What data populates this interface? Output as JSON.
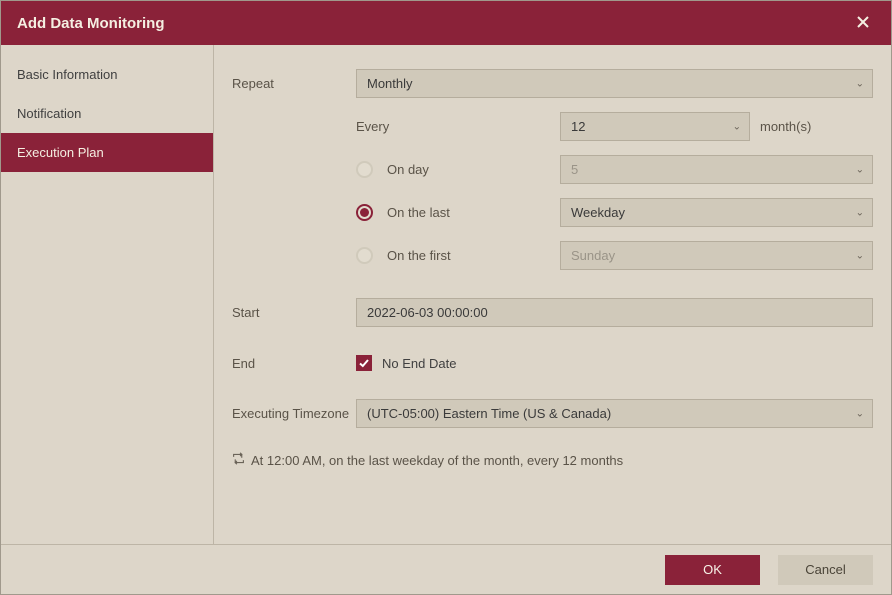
{
  "title": "Add Data Monitoring",
  "sidebar": {
    "items": [
      {
        "label": "Basic Information"
      },
      {
        "label": "Notification"
      },
      {
        "label": "Execution Plan"
      }
    ],
    "active_index": 2
  },
  "form": {
    "repeat_label": "Repeat",
    "repeat_value": "Monthly",
    "every_label": "Every",
    "every_value": "12",
    "every_suffix": "month(s)",
    "on_day_label": "On day",
    "on_day_value": "5",
    "on_last_label": "On the last",
    "on_last_value": "Weekday",
    "on_first_label": "On the first",
    "on_first_value": "Sunday",
    "radio_selected": "on_last",
    "start_label": "Start",
    "start_value": "2022-06-03 00:00:00",
    "end_label": "End",
    "no_end_checked": true,
    "no_end_label": "No End Date",
    "tz_label": "Executing Timezone",
    "tz_value": "(UTC-05:00) Eastern Time (US & Canada)"
  },
  "summary_text": "At 12:00 AM, on the last weekday of the month, every 12 months",
  "footer": {
    "ok": "OK",
    "cancel": "Cancel"
  }
}
